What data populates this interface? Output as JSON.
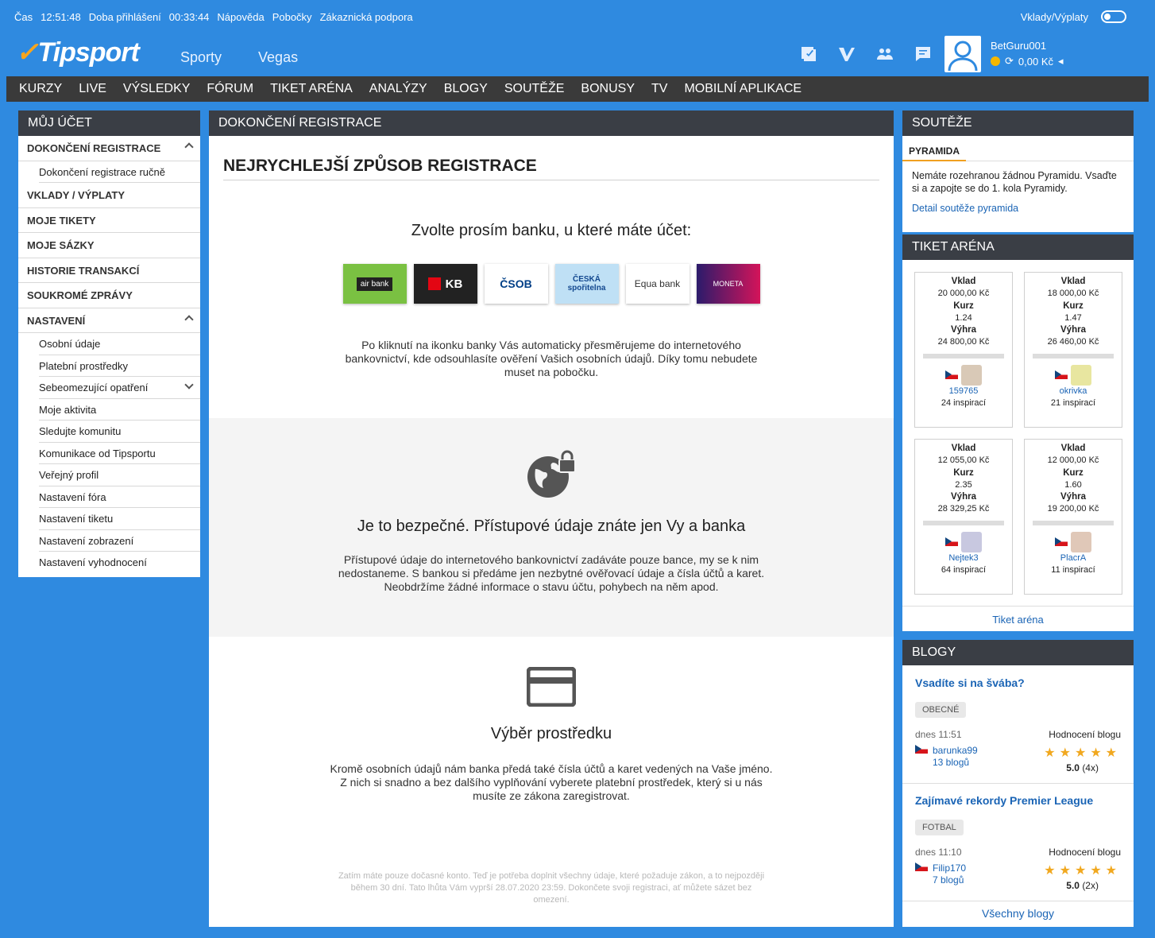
{
  "topbar": {
    "time_label": "Čas",
    "time": "12:51:48",
    "login_label": "Doba přihlášení",
    "login_time": "00:33:44",
    "help": "Nápověda",
    "branches": "Pobočky",
    "support": "Zákaznická podpora",
    "deposits": "Vklady/Výplaty"
  },
  "header": {
    "logo": "Tipsport",
    "nav": [
      "Sporty",
      "Vegas"
    ],
    "username": "BetGuru001",
    "balance": "0,00 Kč"
  },
  "mainnav": [
    "KURZY",
    "LIVE",
    "VÝSLEDKY",
    "FÓRUM",
    "TIKET ARÉNA",
    "ANALÝZY",
    "BLOGY",
    "SOUTĚŽE",
    "BONUSY",
    "TV",
    "MOBILNÍ APLIKACE"
  ],
  "left": {
    "title": "MŮJ ÚČET",
    "items": [
      {
        "label": "DOKONČENÍ REGISTRACE"
      },
      {
        "label": "Dokončení registrace ručně"
      },
      {
        "label": "VKLADY / VÝPLATY"
      },
      {
        "label": "MOJE TIKETY"
      },
      {
        "label": "MOJE SÁZKY"
      },
      {
        "label": "HISTORIE TRANSAKCÍ"
      },
      {
        "label": "SOUKROMÉ ZPRÁVY"
      },
      {
        "label": "NASTAVENÍ"
      },
      {
        "label": "Osobní údaje"
      },
      {
        "label": "Platební prostředky"
      },
      {
        "label": "Sebeomezující opatření"
      },
      {
        "label": "Moje aktivita"
      },
      {
        "label": "Sledujte komunitu"
      },
      {
        "label": "Komunikace od Tipsportu"
      },
      {
        "label": "Veřejný profil"
      },
      {
        "label": "Nastavení fóra"
      },
      {
        "label": "Nastavení tiketu"
      },
      {
        "label": "Nastavení zobrazení"
      },
      {
        "label": "Nastavení vyhodnocení"
      }
    ]
  },
  "center": {
    "header": "DOKONČENÍ REGISTRACE",
    "title": "NEJRYCHLEJŠÍ ZPŮSOB REGISTRACE",
    "choose": "Zvolte prosím banku, u které máte účet:",
    "banks": [
      "air bank",
      "KB",
      "ČSOB",
      "ČESKÁ spořitelna",
      "Equa bank",
      "MONETA"
    ],
    "intro": "Po kliknutí na ikonku banky Vás automaticky přesměrujeme do internetového bankovnictví, kde odsouhlasíte ověření Vašich osobních údajů. Díky tomu nebudete muset na pobočku.",
    "safe_title": "Je to bezpečné. Přístupové údaje znáte jen Vy a banka",
    "safe_text": "Přístupové údaje do internetového bankovnictví zadáváte pouze bance, my se k nim nedostaneme. S bankou si předáme jen nezbytné ověřovací údaje a čísla účtů a karet. Neobdržíme žádné informace o stavu účtu, pohybech na něm apod.",
    "pay_title": "Výběr prostředku",
    "pay_text": "Kromě osobních údajů nám banka předá také čísla účtů a karet vedených na Vaše jméno. Z nich si snadno a bez dalšího vyplňování vyberete platební prostředek, který si u nás musíte ze zákona zaregistrovat.",
    "footnote": "Zatím máte pouze dočasné konto. Teď je potřeba doplnit všechny údaje, které požaduje zákon, a to nejpozději během 30 dní. Tato lhůta Vám vyprší 28.07.2020 23:59. Dokončete svoji registraci, ať můžete sázet bez omezení."
  },
  "souteze": {
    "title": "SOUTĚŽE",
    "tab": "PYRAMIDA",
    "text": "Nemáte rozehranou žádnou Pyramidu. Vsaďte si a zapojte se do 1. kola Pyramidy.",
    "link": "Detail soutěže pyramida"
  },
  "arena": {
    "title": "TIKET ARÉNA",
    "labels": {
      "deposit": "Vklad",
      "odds": "Kurz",
      "win": "Výhra"
    },
    "cards": [
      {
        "deposit": "20 000,00 Kč",
        "odds": "1.24",
        "win": "24 800,00 Kč",
        "user": "159765",
        "insp": "24 inspirací"
      },
      {
        "deposit": "18 000,00 Kč",
        "odds": "1.47",
        "win": "26 460,00 Kč",
        "user": "okrivka",
        "insp": "21 inspirací"
      },
      {
        "deposit": "12 055,00 Kč",
        "odds": "2.35",
        "win": "28 329,25 Kč",
        "user": "Nejtek3",
        "insp": "64 inspirací"
      },
      {
        "deposit": "12 000,00 Kč",
        "odds": "1.60",
        "win": "19 200,00 Kč",
        "user": "PlacrA",
        "insp": "11 inspirací"
      }
    ],
    "link": "Tiket aréna"
  },
  "blogy": {
    "title": "BLOGY",
    "rating_label": "Hodnocení blogu",
    "posts": [
      {
        "title": "Vsadíte si na švába?",
        "tag": "OBECNÉ",
        "time": "dnes 11:51",
        "author": "barunka99",
        "count": "13 blogů",
        "score": "5.0",
        "votes": "(4x)"
      },
      {
        "title": "Zajímavé rekordy Premier League",
        "tag": "FOTBAL",
        "time": "dnes 11:10",
        "author": "Filip170",
        "count": "7 blogů",
        "score": "5.0",
        "votes": "(2x)"
      }
    ],
    "all": "Všechny blogy"
  }
}
